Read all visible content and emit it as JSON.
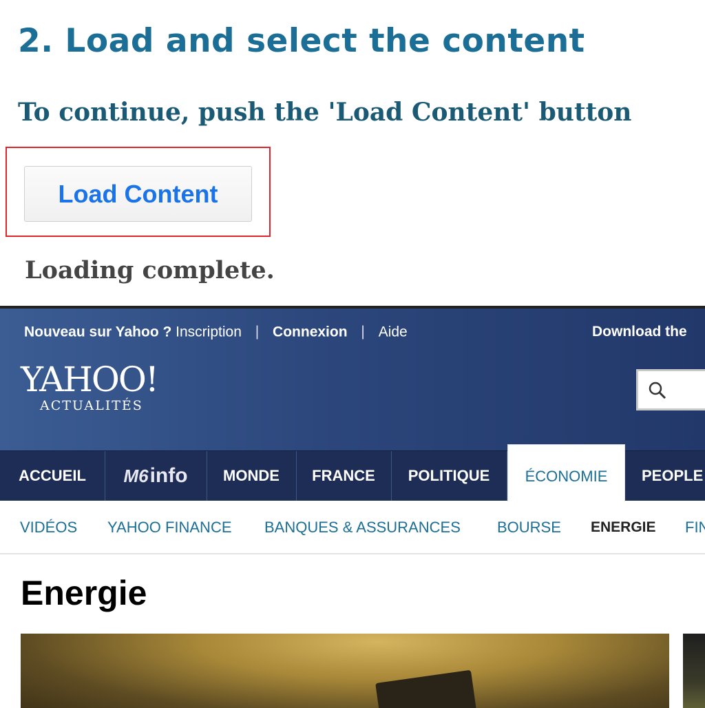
{
  "step_title": "2. Load and select the content",
  "instruction": "To continue, push the 'Load Content' button",
  "load_button_label": "Load Content",
  "status_text": "Loading complete.",
  "yahoo": {
    "topbar": {
      "new_prefix": "Nouveau sur Yahoo ?",
      "inscription": "Inscription",
      "connexion": "Connexion",
      "aide": "Aide",
      "download": "Download the"
    },
    "logo": {
      "name": "YAHOO!",
      "subtitle": "ACTUALITÉS"
    },
    "search_icon": "search-icon",
    "nav": [
      {
        "label": "ACCUEIL"
      },
      {
        "label": "M6 info",
        "logo": true
      },
      {
        "label": "MONDE"
      },
      {
        "label": "FRANCE"
      },
      {
        "label": "POLITIQUE"
      },
      {
        "label": "ÉCONOMIE",
        "active": true
      },
      {
        "label": "PEOPLE"
      }
    ],
    "subnav": [
      {
        "label": "VIDÉOS"
      },
      {
        "label": "YAHOO FINANCE"
      },
      {
        "label": "BANQUES & ASSURANCES"
      },
      {
        "label": "BOURSE"
      },
      {
        "label": "ENERGIE",
        "current": true
      },
      {
        "label": "FIN"
      }
    ],
    "section_title": "Energie"
  },
  "colors": {
    "step_title": "#1b6e96",
    "highlight_border": "#e0242b",
    "button_text": "#1a73e8",
    "yahoo_header": "#2c477c",
    "nav_bg": "#1e2d55"
  }
}
